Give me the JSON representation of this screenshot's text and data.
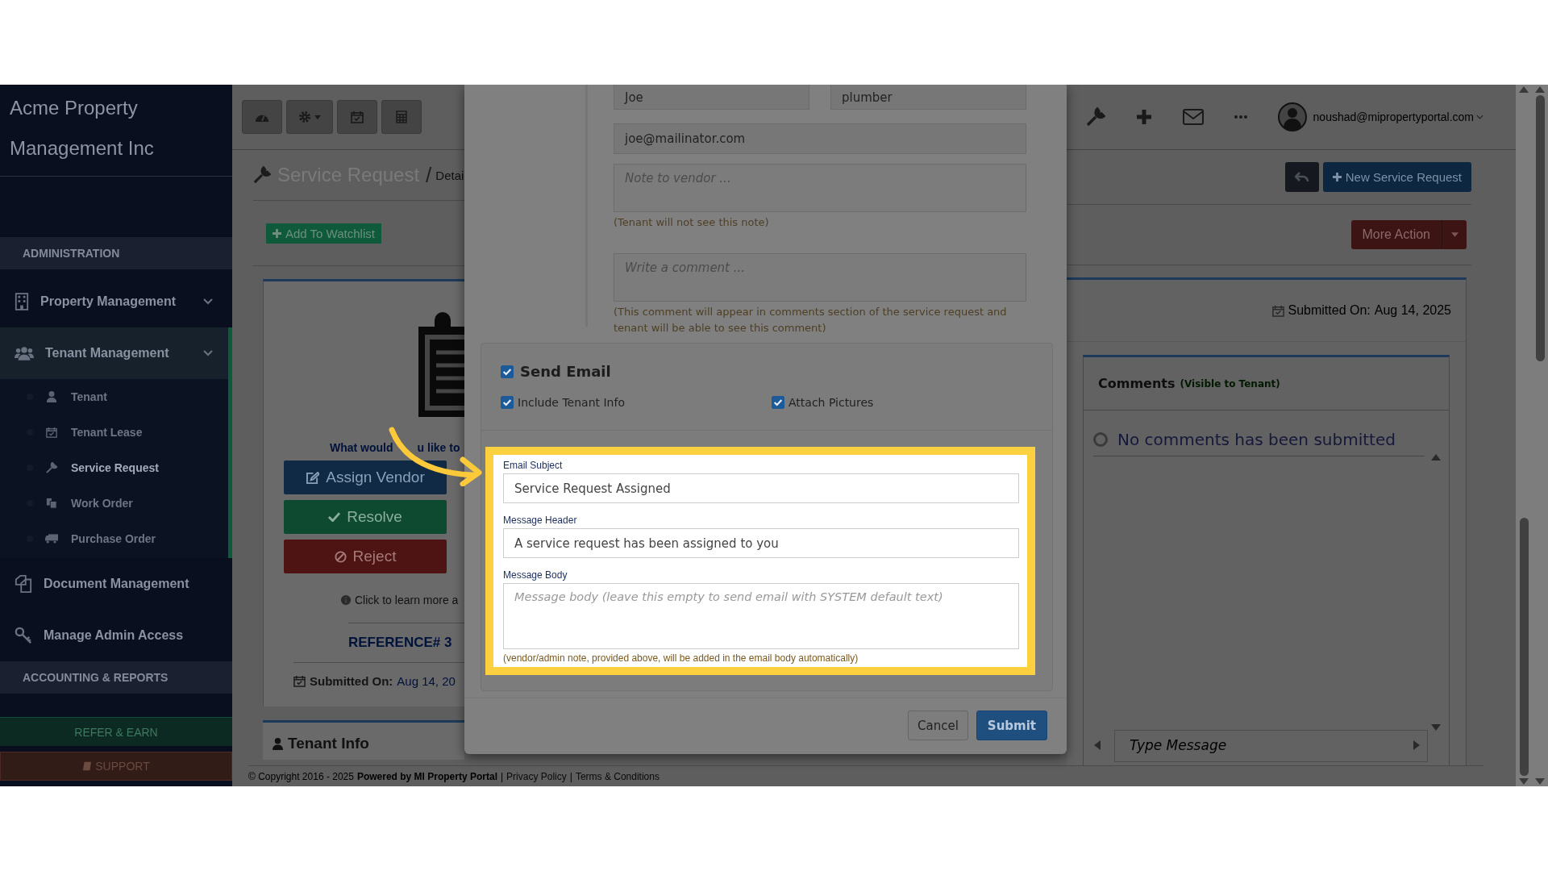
{
  "sidebar": {
    "brand": "Acme Property Management Inc",
    "items": [
      {
        "kind": "section",
        "label": "ADMINISTRATION"
      },
      {
        "kind": "group",
        "label": "Property Management",
        "selected": false
      },
      {
        "kind": "group",
        "label": "Tenant Management",
        "selected": true,
        "children": [
          {
            "label": "Tenant",
            "selected": false
          },
          {
            "label": "Tenant Lease",
            "selected": false
          },
          {
            "label": "Service Request",
            "selected": true
          },
          {
            "label": "Work Order",
            "selected": false
          },
          {
            "label": "Purchase Order",
            "selected": false
          }
        ]
      },
      {
        "kind": "link",
        "label": "Document Management",
        "selected": false
      },
      {
        "kind": "link",
        "label": "Manage Admin Access",
        "selected": false
      },
      {
        "kind": "section",
        "label": "ACCOUNTING & REPORTS"
      }
    ],
    "buttons": [
      {
        "label": "REFER & EARN",
        "kind": "refer"
      },
      {
        "label": "SUPPORT",
        "kind": "support"
      }
    ]
  },
  "topbar": {
    "user": "noushad@mipropertyportal.com"
  },
  "page": {
    "title": "Service Request",
    "separator": "/",
    "crumb": "Detai",
    "watchlist": "Add To Watchlist",
    "new_request": "New Service Request",
    "more_action": "More Action",
    "prompt": [
      "What would",
      "u like to"
    ],
    "actions": [
      {
        "label": "Assign Vendor",
        "kind": "assign"
      },
      {
        "label": "Resolve",
        "kind": "resolve"
      },
      {
        "label": "Reject",
        "kind": "reject"
      }
    ],
    "learn_more": "Click to learn more a",
    "reference": "REFERENCE# 3",
    "submitted_label": "Submitted On:",
    "submitted_date": "Aug 14, 20",
    "tenant_info": "Tenant Info",
    "right_submitted_label": "Submitted On:",
    "right_submitted_date": "Aug 14, 2025"
  },
  "comments": {
    "title": "Comments",
    "note": "(Visible to Tenant)",
    "empty": "No comments has been submitted",
    "input_placeholder": "Type Message"
  },
  "modal": {
    "first_name": "Joe",
    "vendor_type": "plumber",
    "email": "joe@mailinator.com",
    "note_placeholder": "Note to vendor ...",
    "note_hint": "(Tenant will not see this note)",
    "comment_placeholder": "Write a comment ...",
    "comment_hint": "(This comment will appear in comments section of the service request and tenant will be able to see this comment)",
    "send_email": {
      "label": "Send Email",
      "checked": true
    },
    "options": [
      {
        "label": "Include Tenant Info",
        "checked": true
      },
      {
        "label": "Attach Pictures",
        "checked": true
      }
    ],
    "email_subject": {
      "label": "Email Subject",
      "value": "Service Request Assigned"
    },
    "message_header": {
      "label": "Message Header",
      "value": "A service request has been assigned to you"
    },
    "message_body": {
      "label": "Message Body",
      "placeholder": "Message body (leave this empty to send email with SYSTEM default text)"
    },
    "body_hint": "(vendor/admin note, provided above, will be added in the email body automatically)",
    "buttons": [
      {
        "label": "Cancel",
        "kind": "default"
      },
      {
        "label": "Submit",
        "kind": "primary"
      }
    ]
  },
  "footer": {
    "separator": "|",
    "copyright": "© Copyright 2016 - 2025",
    "powered": "Powered by MI Property Portal",
    "links": [
      "Privacy Policy",
      "Terms & Conditions"
    ]
  }
}
